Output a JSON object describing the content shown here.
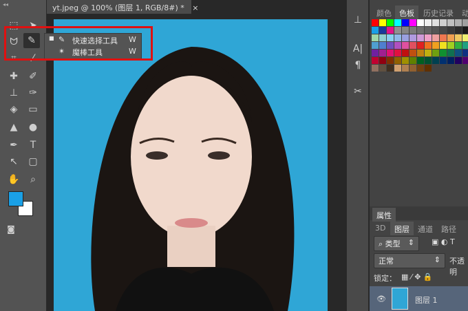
{
  "document": {
    "tab_title": "yt.jpeg @ 100% (图层 1, RGB/8#) *",
    "close": "×"
  },
  "toolbar": {
    "collapse": "◂◂",
    "foreground_color": "#1aa0e6",
    "background_color": "#ffffff"
  },
  "flyout": {
    "items": [
      {
        "label": "快速选择工具",
        "shortcut": "W",
        "selected": true
      },
      {
        "label": "魔棒工具",
        "shortcut": "W",
        "selected": false
      }
    ]
  },
  "swatch_panel": {
    "tabs": [
      "颜色",
      "色板",
      "历史记录",
      "动"
    ],
    "active_tab": "色板",
    "colors": [
      "#ff0000",
      "#ffff00",
      "#00ff00",
      "#00ffff",
      "#0000ff",
      "#ff00ff",
      "#ffffff",
      "#f0f0f0",
      "#e0e0e0",
      "#d0d0d0",
      "#c0c0c0",
      "#b0b0b0",
      "#a0a0a0",
      "#909090",
      "#1aa0e6",
      "#1a3a9a",
      "#e0148a",
      "#909090",
      "#858585",
      "#7a7a7a",
      "#6e6e6e",
      "#626262",
      "#555555",
      "#484848",
      "#3a3a3a",
      "#2c2c2c",
      "#1a1a1a",
      "#000000",
      "#9fd8a8",
      "#8fd0d0",
      "#8acff0",
      "#8fb8e8",
      "#9aa0e0",
      "#b09ae0",
      "#d09ad8",
      "#f0a0c8",
      "#f0a0a0",
      "#f07850",
      "#f0a050",
      "#f0c860",
      "#f0f070",
      "#c8e870",
      "#4f9fd0",
      "#4f7fd0",
      "#7050c0",
      "#b050c0",
      "#e050a0",
      "#e05060",
      "#e02020",
      "#f07020",
      "#f0a020",
      "#f0e020",
      "#a0d020",
      "#30b040",
      "#20a080",
      "#2080b0",
      "#7020a0",
      "#a02090",
      "#e01070",
      "#e01040",
      "#c01010",
      "#c05010",
      "#c08010",
      "#c0b010",
      "#70a010",
      "#109030",
      "#107050",
      "#105080",
      "#103080",
      "#301080",
      "#c00030",
      "#900010",
      "#803000",
      "#906000",
      "#a09000",
      "#608000",
      "#006020",
      "#005030",
      "#004050",
      "#003070",
      "#002060",
      "#200060",
      "#500070",
      "#700040",
      "#907060",
      "#605040",
      "#403020",
      "#d0a070",
      "#b08050",
      "#906030",
      "#704010",
      "#603000"
    ]
  },
  "properties_panel": {
    "title": "属性"
  },
  "layers_panel": {
    "tabs": [
      "3D",
      "图层",
      "通道",
      "路径"
    ],
    "active_tab": "图层",
    "filter": "类型",
    "blend_mode": "正常",
    "opacity_label": "不透明",
    "lock_label": "锁定：",
    "layers": [
      {
        "name": "图层 1",
        "visible": true
      }
    ]
  }
}
